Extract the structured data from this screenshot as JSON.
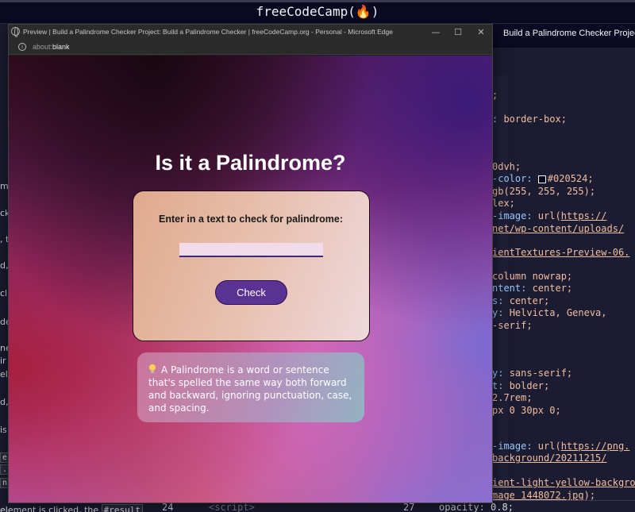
{
  "app": {
    "title": "freeCodeCamp(🔥)"
  },
  "right_panel": {
    "header": "Build a Palindrome Checker Project"
  },
  "left_panel": {
    "fragments": [
      "me",
      "cke",
      ", th",
      "d, ",
      "clic",
      "der",
      "ne",
      "ir",
      "ele",
      "d,",
      "is c"
    ],
    "snippets": [
      "ec",
      ".",
      "n"
    ],
    "bottom_text_prefix": "element is clicked, the ",
    "bottom_code": "#result"
  },
  "edge": {
    "title": "Preview | Build a Palindrome Checker Project: Build a Palindrome Checker | freeCodeCamp.org - Personal - Microsoft Edge",
    "url_prefix": "about:",
    "url_rest": "blank",
    "minimize": "—",
    "maximize": "☐",
    "close": "✕"
  },
  "preview": {
    "heading": "Is it a Palindrome?",
    "label": "Enter in a text to check for palindrome:",
    "input_value": "",
    "button_label": "Check",
    "info_text": "A Palindrome is a word or sentence that's spelled the same way both forward and backward, ignoring punctuation, case, and spacing."
  },
  "code_right": [
    {
      "k": "",
      "v": ";"
    },
    {
      "k": ": ",
      "v": "border-box;"
    },
    {
      "k": "",
      "v": "0dvh;"
    },
    {
      "k": "-color: ",
      "v": "#020524;"
    },
    {
      "k": "",
      "v": "gb(255, 255, 255);"
    },
    {
      "k": "",
      "v": "lex;"
    },
    {
      "k": "-image: ",
      "v": "url(",
      "link": "https://"
    },
    {
      "k": "",
      "v": "",
      "link": "net/wp-content/uploads/"
    },
    {
      "k": "",
      "v": "",
      "link": "ientTextures-Preview-06."
    },
    {
      "k": "",
      "v": " column nowrap;"
    },
    {
      "k": "ntent: ",
      "v": "center;"
    },
    {
      "k": "s: ",
      "v": "center;"
    },
    {
      "k": "y: ",
      "v": "Helvicta, Geneva,"
    },
    {
      "k": "",
      "v": "-serif;"
    },
    {
      "k": "y: ",
      "v": "sans-serif;"
    },
    {
      "k": "t: ",
      "v": "bolder;"
    },
    {
      "k": "",
      "v": " 2.7rem;"
    },
    {
      "k": "",
      "v": "px 0 30px 0;"
    },
    {
      "k": "-image: ",
      "v": "url(",
      "link": "https://png."
    },
    {
      "k": "",
      "v": "",
      "link": "background/20211215/"
    },
    {
      "k": "",
      "v": "",
      "link": "ient-light-yellow-backgrou"
    },
    {
      "k": "",
      "v": ");",
      "link": "mage_1448072.jpg"
    }
  ],
  "bottom_bar": {
    "line_a": "24",
    "tag": "<script>",
    "line_b": "27",
    "text": "opacity: 0.8;"
  },
  "colors": {
    "accent": "#5a3294",
    "bg": "#0a0a23",
    "swatch": "#020524"
  }
}
